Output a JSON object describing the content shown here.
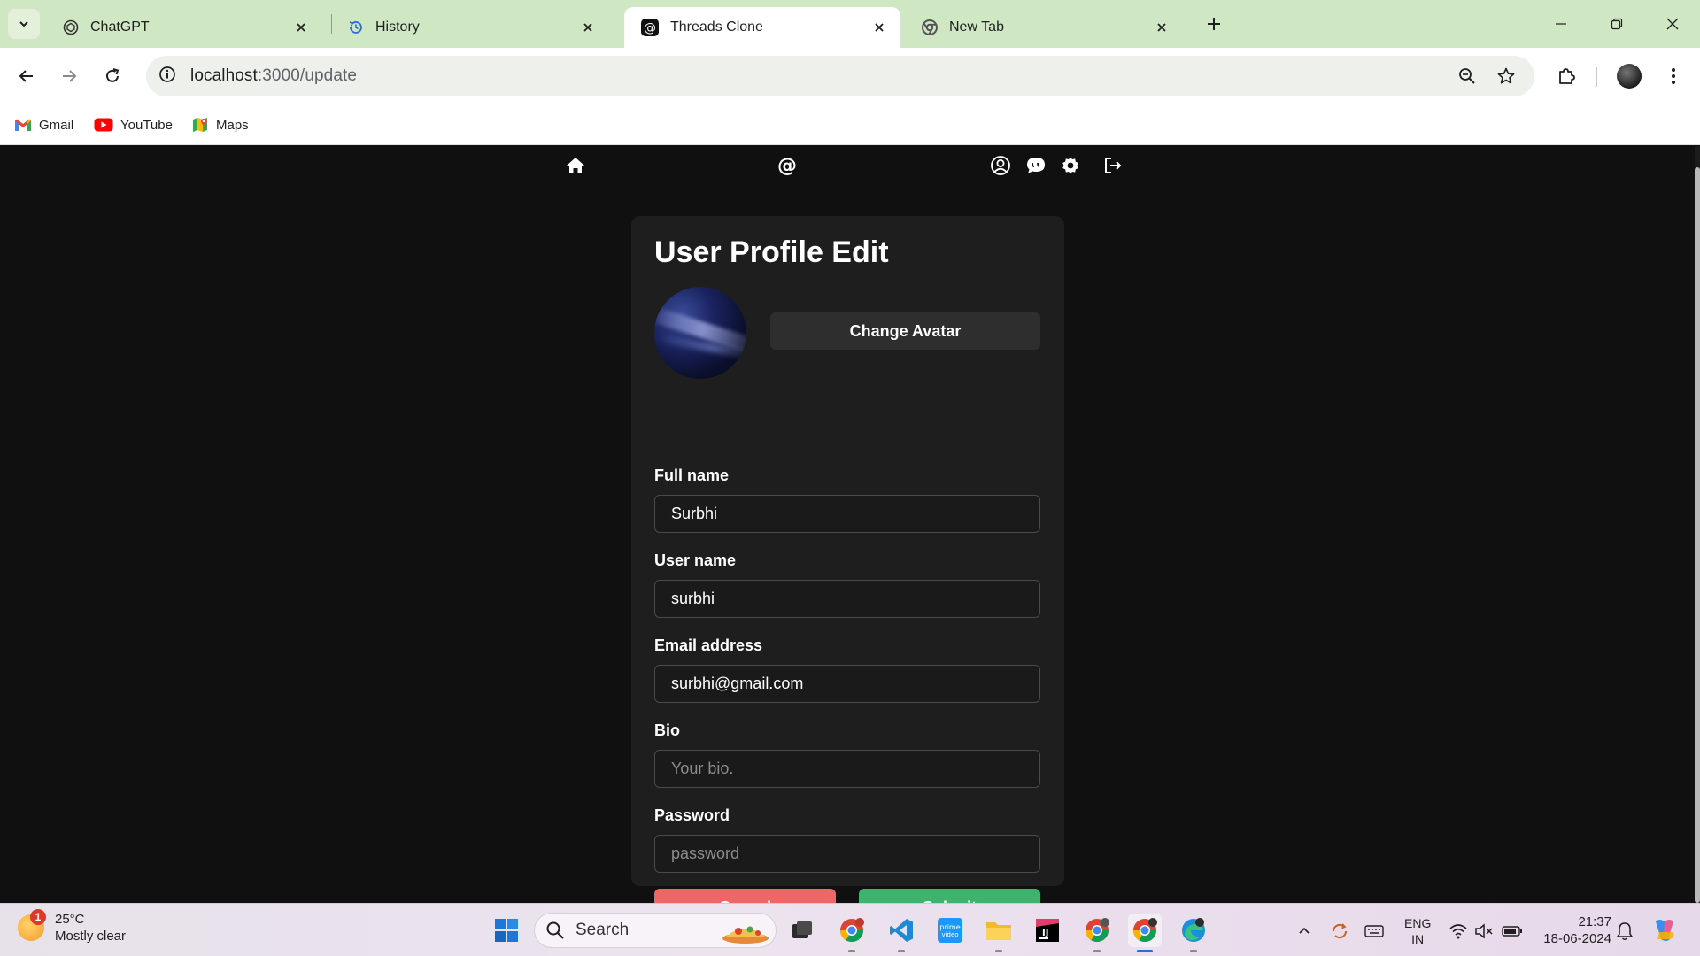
{
  "browser": {
    "tabs": [
      {
        "title": "ChatGPT",
        "icon": "chatgpt-icon"
      },
      {
        "title": "History",
        "icon": "history-icon"
      },
      {
        "title": "Threads Clone",
        "icon": "threads-icon",
        "active": true
      },
      {
        "title": "New Tab",
        "icon": "chrome-icon"
      }
    ],
    "url_host": "localhost",
    "url_path": ":3000/update",
    "bookmarks": [
      {
        "label": "Gmail",
        "icon": "gmail-icon"
      },
      {
        "label": "YouTube",
        "icon": "youtube-icon"
      },
      {
        "label": "Maps",
        "icon": "maps-icon"
      }
    ]
  },
  "app": {
    "header_icons": [
      "home-icon",
      "threads-logo-icon",
      "profile-icon",
      "chat-icon",
      "settings-icon",
      "logout-icon"
    ]
  },
  "form": {
    "title": "User Profile Edit",
    "change_avatar_label": "Change Avatar",
    "fields": {
      "fullname": {
        "label": "Full name",
        "value": "Surbhi",
        "placeholder": ""
      },
      "username": {
        "label": "User name",
        "value": "surbhi",
        "placeholder": ""
      },
      "email": {
        "label": "Email address",
        "value": "surbhi@gmail.com",
        "placeholder": ""
      },
      "bio": {
        "label": "Bio",
        "value": "",
        "placeholder": "Your bio."
      },
      "password": {
        "label": "Password",
        "value": "",
        "placeholder": "password"
      }
    },
    "cancel_label": "Cancel",
    "submit_label": "Submit"
  },
  "taskbar": {
    "weather_temp": "25°C",
    "weather_desc": "Mostly clear",
    "weather_badge": "1",
    "search_label": "Search",
    "lang_line1": "ENG",
    "lang_line2": "IN",
    "time": "21:37",
    "date": "18-06-2024"
  },
  "colors": {
    "page_bg": "#101010",
    "card_bg": "#1e1e1e",
    "cancel": "#f06565",
    "submit": "#3db36e",
    "tabstrip": "#cfe7c3"
  }
}
